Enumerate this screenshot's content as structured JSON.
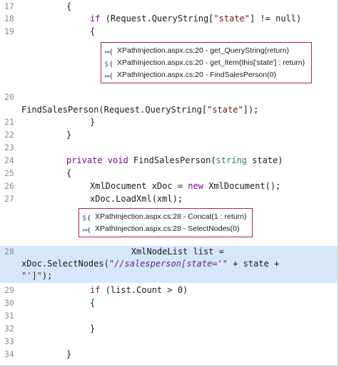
{
  "lines": [
    {
      "n": "17",
      "text": "        {"
    },
    {
      "n": "18",
      "pre": "        ",
      "kw": "if",
      "mid": " (Request.QueryString[",
      "str": "\"state\"",
      "post": "] != null)"
    },
    {
      "n": "19",
      "text": "        {"
    },
    {
      "n": "20",
      "text": "FindSalesPerson(Request.QueryString[",
      "str": "\"state\"",
      "post": "]);"
    },
    {
      "n": "21",
      "text": "        }"
    },
    {
      "n": "22",
      "text": "    }"
    },
    {
      "n": "23",
      "text": ""
    },
    {
      "n": "24",
      "pre": "    ",
      "kw": "private",
      "kw2": "void",
      "mid": " FindSalesPerson(",
      "type": "string",
      "post": " state)"
    },
    {
      "n": "25",
      "text": "    {"
    },
    {
      "n": "26",
      "pre": "        XmlDocument xDoc = ",
      "kw": "new",
      "post": " XmlDocument();"
    },
    {
      "n": "27",
      "text": "        xDoc.LoadXml(xml);"
    },
    {
      "n": "28",
      "line1": "        XmlNodeList list =",
      "line2a": "xDoc.SelectNodes(",
      "line2str": "\"//salesperson[state='\"",
      "line2b": " + state +",
      "line3": "\"']\"",
      "line3b": ");"
    },
    {
      "n": "29",
      "pre": "        ",
      "kw": "if",
      "post": " (list.Count > 0)"
    },
    {
      "n": "30",
      "text": "        {"
    },
    {
      "n": "31",
      "text": ""
    },
    {
      "n": "32",
      "text": "        }"
    },
    {
      "n": "33",
      "text": ""
    },
    {
      "n": "34",
      "text": "    }"
    }
  ],
  "trace1": [
    {
      "icon": "trace-arrow-icon",
      "label": "XPathInjection.aspx.cs:20 - get_QueryString(return)"
    },
    {
      "icon": "trace-arrow-dollar-icon",
      "label": "XPathInjection.aspx.cs:20 - get_Item(this['state'] : return)"
    },
    {
      "icon": "trace-arrow-icon",
      "label": "XPathInjection.aspx.cs:20 - FindSalesPerson(0)"
    }
  ],
  "trace2": [
    {
      "icon": "trace-arrow-dollar-icon",
      "label": "XPathInjection.aspx.cs:28 - Concat(1 : return)"
    },
    {
      "icon": "trace-arrow-icon",
      "label": "XPathInjection.aspx.cs:28 - SelectNodes(0)"
    }
  ]
}
